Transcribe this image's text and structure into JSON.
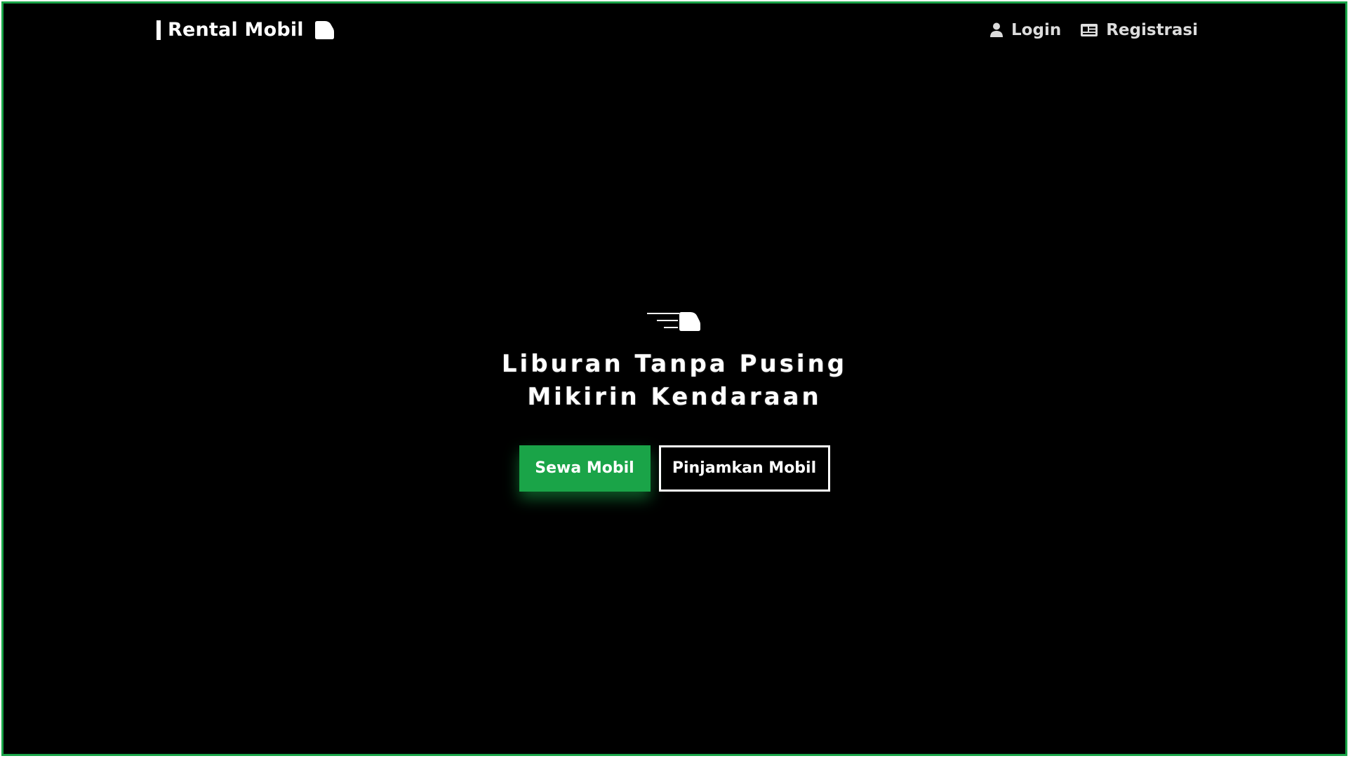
{
  "colors": {
    "accent": "#1aa448",
    "background": "#000000",
    "text": "#ffffff"
  },
  "navbar": {
    "brand": {
      "label": "Rental Mobil",
      "icon": "car-icon"
    },
    "links": [
      {
        "label": "Login",
        "icon": "user-icon"
      },
      {
        "label": "Registrasi",
        "icon": "id-card-icon"
      }
    ]
  },
  "hero": {
    "logo_icon": "speeding-car-icon",
    "title_line1": "Liburan Tanpa Pusing",
    "title_line2": "Mikirin Kendaraan",
    "primary_button": "Sewa Mobil",
    "secondary_button": "Pinjamkan Mobil"
  }
}
